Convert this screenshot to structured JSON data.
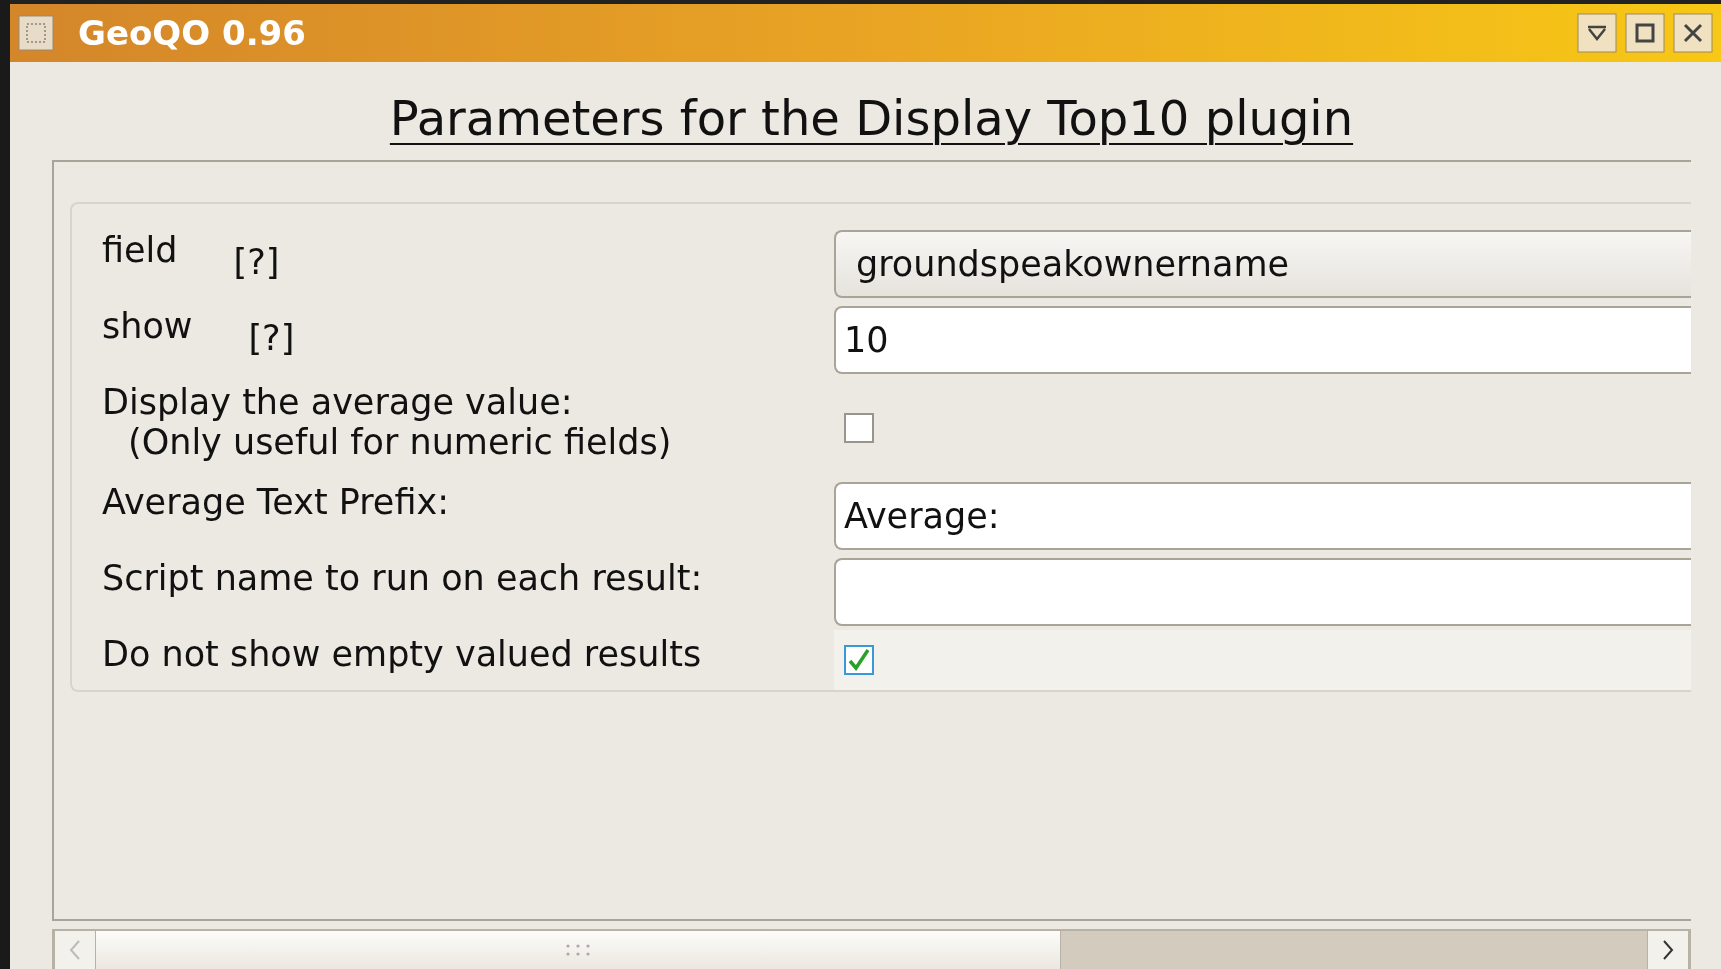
{
  "window": {
    "title": "GeoQO 0.96"
  },
  "heading": "Parameters for the Display Top10 plugin",
  "rows": [
    {
      "kind": "combo",
      "label": "field",
      "help": "[?]",
      "value": "groundspeakownername"
    },
    {
      "kind": "text",
      "label": "show",
      "help": "[?]",
      "value": "10"
    },
    {
      "kind": "check",
      "label": "Display the average value:",
      "note": "(Only useful for numeric fields)",
      "checked": false
    },
    {
      "kind": "text",
      "label": "Average Text Prefix:",
      "value": "Average:"
    },
    {
      "kind": "text",
      "label": "Script name to run on each result:"
    },
    {
      "kind": "check",
      "label": "Do not show empty valued results",
      "checked": true
    }
  ]
}
